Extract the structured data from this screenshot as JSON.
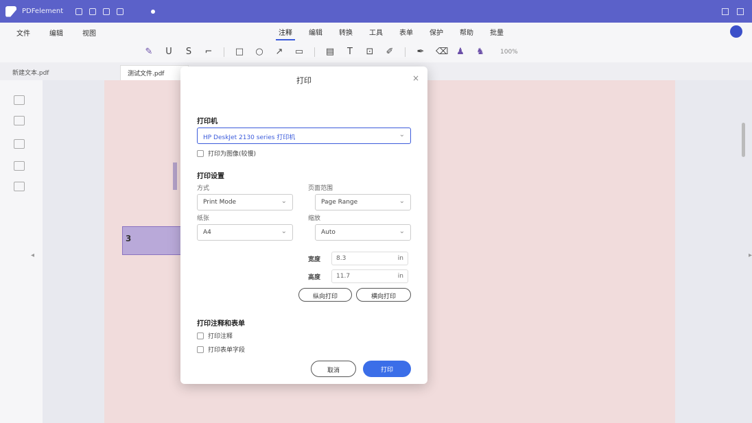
{
  "window": {
    "app_name": "PDFelement",
    "accent": "#5b61c9"
  },
  "menu": {
    "left": [
      "文件",
      "编辑",
      "视图"
    ],
    "tabs": [
      "注释",
      "编辑",
      "转换",
      "工具",
      "表单",
      "保护",
      "帮助",
      "批量"
    ],
    "active_tab": 0
  },
  "toolbar": {
    "zoom": "100%"
  },
  "doc_tabs": {
    "first": "新建文本.pdf",
    "second": "测试文件.pdf"
  },
  "page": {
    "highlight_label": "3"
  },
  "dialog": {
    "title": "打印",
    "printer_section": "打印机",
    "printer_value": "HP DeskJet 2130 series 打印机",
    "print_as_image": "打印为图像(较慢)",
    "settings_section": "打印设置",
    "mode_label": "方式",
    "mode_value": "Print Mode",
    "page_range_label": "页面范围",
    "page_range_value": "Page Range",
    "paper_label": "纸张",
    "paper_value": "A4",
    "scale_label": "缩放",
    "scale_value": "Auto",
    "width_label": "宽度",
    "width_value": "8.3",
    "height_label": "高度",
    "height_value": "11.7",
    "unit": "in",
    "btn_portrait": "纵向打印",
    "btn_landscape": "横向打印",
    "options_section": "打印注释和表单",
    "option1": "打印注释",
    "option2": "打印表单字段",
    "cancel": "取消",
    "print": "打印"
  }
}
